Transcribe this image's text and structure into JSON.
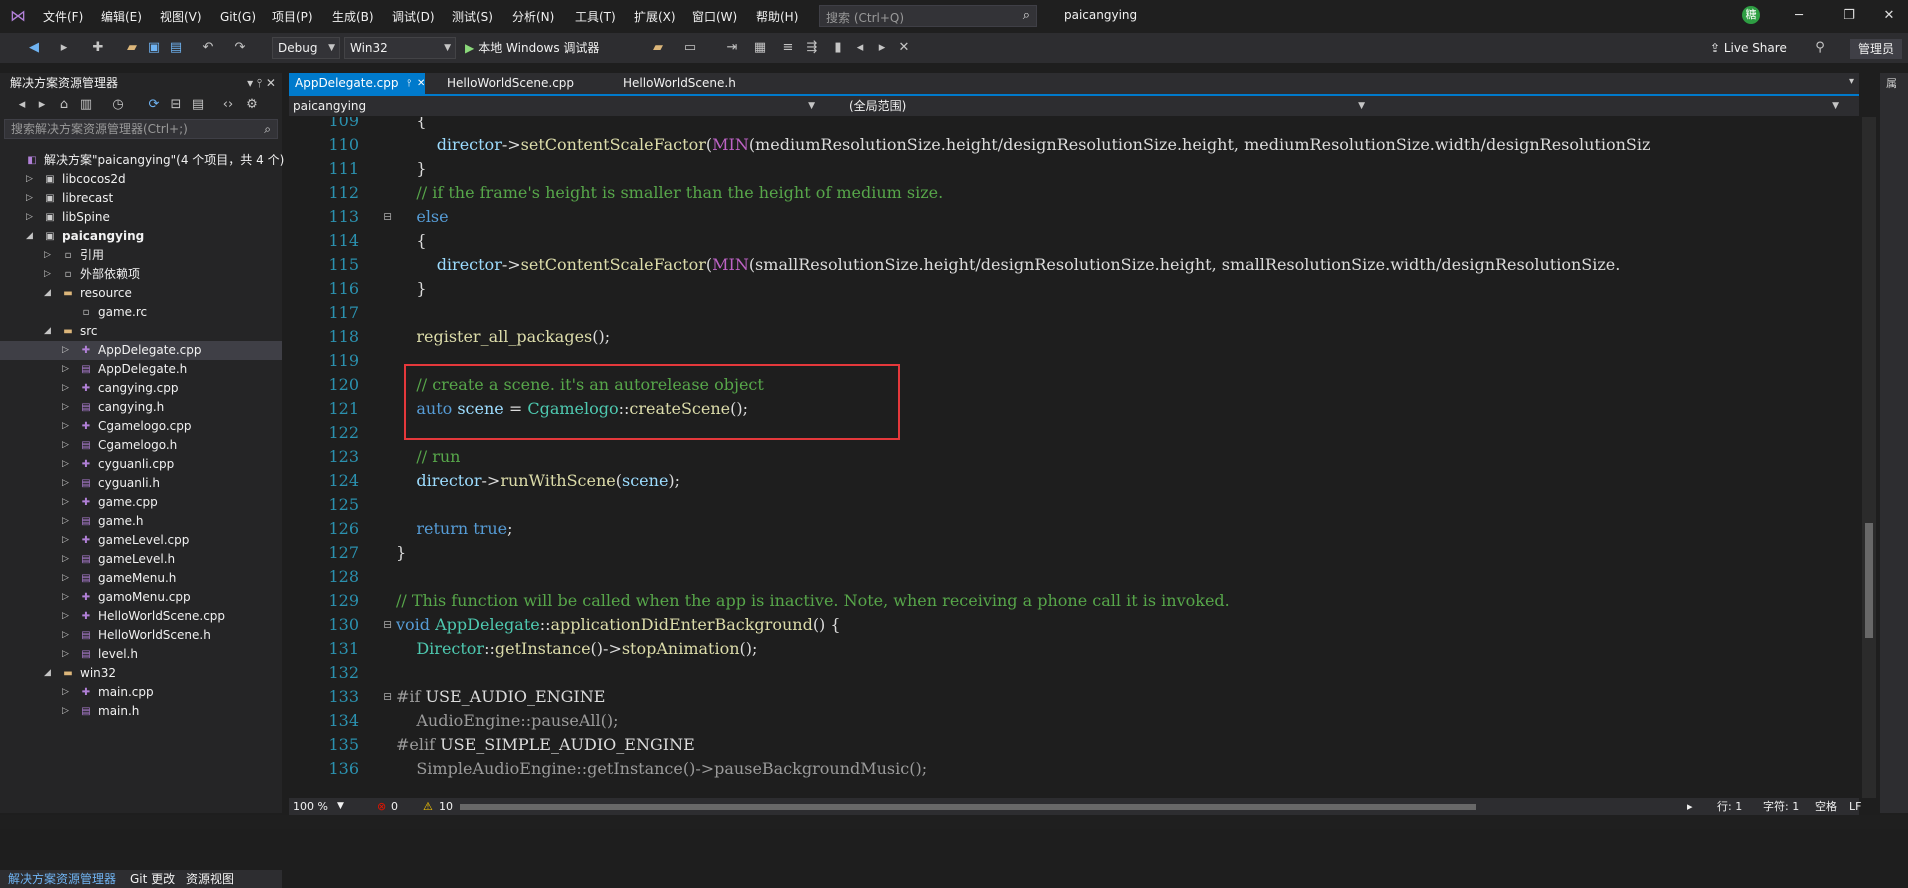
{
  "menubar": {
    "items": [
      "文件(F)",
      "编辑(E)",
      "视图(V)",
      "Git(G)",
      "项目(P)",
      "生成(B)",
      "调试(D)",
      "测试(S)",
      "分析(N)",
      "工具(T)",
      "扩展(X)",
      "窗口(W)",
      "帮助(H)"
    ],
    "search_placeholder": "搜索 (Ctrl+Q)",
    "solution_name": "paicangying",
    "avatar_letter": "糖"
  },
  "toolbar": {
    "config": "Debug",
    "platform": "Win32",
    "run_label": "本地 Windows 调试器",
    "liveshare": "Live Share",
    "admin": "管理员"
  },
  "solution_explorer": {
    "title": "解决方案资源管理器",
    "search_placeholder": "搜索解决方案资源管理器(Ctrl+;)",
    "tree": [
      {
        "label": "解决方案\"paicangying\"(4 个项目，共 4 个)",
        "indent": 0,
        "arrow": "",
        "icon": "sln"
      },
      {
        "label": "libcocos2d",
        "indent": 1,
        "arrow": "▷",
        "icon": "proj"
      },
      {
        "label": "librecast",
        "indent": 1,
        "arrow": "▷",
        "icon": "proj"
      },
      {
        "label": "libSpine",
        "indent": 1,
        "arrow": "▷",
        "icon": "proj"
      },
      {
        "label": "paicangying",
        "indent": 1,
        "arrow": "◢",
        "icon": "proj",
        "bold": true
      },
      {
        "label": "引用",
        "indent": 2,
        "arrow": "▷",
        "icon": "file"
      },
      {
        "label": "外部依赖项",
        "indent": 2,
        "arrow": "▷",
        "icon": "file"
      },
      {
        "label": "resource",
        "indent": 2,
        "arrow": "◢",
        "icon": "folder"
      },
      {
        "label": "game.rc",
        "indent": 3,
        "arrow": "",
        "icon": "file"
      },
      {
        "label": "src",
        "indent": 2,
        "arrow": "◢",
        "icon": "folder"
      },
      {
        "label": "AppDelegate.cpp",
        "indent": 3,
        "arrow": "▷",
        "icon": "cpp",
        "selected": true
      },
      {
        "label": "AppDelegate.h",
        "indent": 3,
        "arrow": "▷",
        "icon": "h"
      },
      {
        "label": "cangying.cpp",
        "indent": 3,
        "arrow": "▷",
        "icon": "cpp"
      },
      {
        "label": "cangying.h",
        "indent": 3,
        "arrow": "▷",
        "icon": "h"
      },
      {
        "label": "Cgamelogo.cpp",
        "indent": 3,
        "arrow": "▷",
        "icon": "cpp"
      },
      {
        "label": "Cgamelogo.h",
        "indent": 3,
        "arrow": "▷",
        "icon": "h"
      },
      {
        "label": "cyguanli.cpp",
        "indent": 3,
        "arrow": "▷",
        "icon": "cpp"
      },
      {
        "label": "cyguanli.h",
        "indent": 3,
        "arrow": "▷",
        "icon": "h"
      },
      {
        "label": "game.cpp",
        "indent": 3,
        "arrow": "▷",
        "icon": "cpp"
      },
      {
        "label": "game.h",
        "indent": 3,
        "arrow": "▷",
        "icon": "h"
      },
      {
        "label": "gameLevel.cpp",
        "indent": 3,
        "arrow": "▷",
        "icon": "cpp"
      },
      {
        "label": "gameLevel.h",
        "indent": 3,
        "arrow": "▷",
        "icon": "h"
      },
      {
        "label": "gameMenu.h",
        "indent": 3,
        "arrow": "▷",
        "icon": "h"
      },
      {
        "label": "gamoMenu.cpp",
        "indent": 3,
        "arrow": "▷",
        "icon": "cpp"
      },
      {
        "label": "HelloWorldScene.cpp",
        "indent": 3,
        "arrow": "▷",
        "icon": "cpp"
      },
      {
        "label": "HelloWorldScene.h",
        "indent": 3,
        "arrow": "▷",
        "icon": "h"
      },
      {
        "label": "level.h",
        "indent": 3,
        "arrow": "▷",
        "icon": "h"
      },
      {
        "label": "win32",
        "indent": 2,
        "arrow": "◢",
        "icon": "folder"
      },
      {
        "label": "main.cpp",
        "indent": 3,
        "arrow": "▷",
        "icon": "cpp"
      },
      {
        "label": "main.h",
        "indent": 3,
        "arrow": "▷",
        "icon": "h"
      }
    ],
    "bottom_tabs": [
      "解决方案资源管理器",
      "Git 更改",
      "资源视图"
    ]
  },
  "editor": {
    "tabs": [
      "AppDelegate.cpp",
      "HelloWorldScene.cpp",
      "HelloWorldScene.h"
    ],
    "nav_project": "paicangying",
    "nav_scope": "(全局范围)",
    "zoom": "100 %",
    "errors": "0",
    "warnings": "10",
    "status_line": "行: 1",
    "status_col": "字符: 1",
    "status_ws": "空格",
    "status_eol": "LF",
    "lines": [
      {
        "n": "109",
        "fold": "",
        "tokens": [
          [
            "    {",
            ""
          ]
        ]
      },
      {
        "n": "110",
        "fold": "",
        "tokens": [
          [
            "        ",
            ""
          ],
          [
            "director",
            "var"
          ],
          [
            "->",
            ""
          ],
          [
            "setContentScaleFactor",
            "fn"
          ],
          [
            "(",
            ""
          ],
          [
            "MIN",
            "mc"
          ],
          [
            "(mediumResolutionSize.height/designResolutionSize.height, mediumResolutionSize.width/designResolutionSiz",
            ""
          ]
        ]
      },
      {
        "n": "111",
        "fold": "",
        "tokens": [
          [
            "    }",
            ""
          ]
        ]
      },
      {
        "n": "112",
        "fold": "",
        "tokens": [
          [
            "    // if the frame's height is smaller than the height of medium size.",
            "cm"
          ]
        ]
      },
      {
        "n": "113",
        "fold": "⊟",
        "tokens": [
          [
            "    ",
            ""
          ],
          [
            "else",
            "kw"
          ]
        ]
      },
      {
        "n": "114",
        "fold": "",
        "tokens": [
          [
            "    {",
            ""
          ]
        ]
      },
      {
        "n": "115",
        "fold": "",
        "tokens": [
          [
            "        ",
            ""
          ],
          [
            "director",
            "var"
          ],
          [
            "->",
            ""
          ],
          [
            "setContentScaleFactor",
            "fn"
          ],
          [
            "(",
            ""
          ],
          [
            "MIN",
            "mc"
          ],
          [
            "(smallResolutionSize.height/designResolutionSize.height, smallResolutionSize.width/designResolutionSize.",
            ""
          ]
        ]
      },
      {
        "n": "116",
        "fold": "",
        "tokens": [
          [
            "    }",
            ""
          ]
        ]
      },
      {
        "n": "117",
        "fold": "",
        "tokens": [
          [
            "",
            ""
          ]
        ]
      },
      {
        "n": "118",
        "fold": "",
        "tokens": [
          [
            "    ",
            ""
          ],
          [
            "register_all_packages",
            "fn"
          ],
          [
            "();",
            ""
          ]
        ]
      },
      {
        "n": "119",
        "fold": "",
        "tokens": [
          [
            "",
            ""
          ]
        ]
      },
      {
        "n": "120",
        "fold": "",
        "tokens": [
          [
            "    // create a scene. it's an autorelease object",
            "cm"
          ]
        ]
      },
      {
        "n": "121",
        "fold": "",
        "tokens": [
          [
            "    ",
            ""
          ],
          [
            "auto",
            "kw"
          ],
          [
            " ",
            ""
          ],
          [
            "scene",
            "var"
          ],
          [
            " = ",
            ""
          ],
          [
            "Cgamelogo",
            "ty"
          ],
          [
            "::",
            ""
          ],
          [
            "createScene",
            "fn"
          ],
          [
            "();",
            ""
          ]
        ]
      },
      {
        "n": "122",
        "fold": "",
        "tokens": [
          [
            "",
            ""
          ]
        ]
      },
      {
        "n": "123",
        "fold": "",
        "tokens": [
          [
            "    // run",
            "cm"
          ]
        ]
      },
      {
        "n": "124",
        "fold": "",
        "tokens": [
          [
            "    ",
            ""
          ],
          [
            "director",
            "var"
          ],
          [
            "->",
            ""
          ],
          [
            "runWithScene",
            "fn"
          ],
          [
            "(",
            ""
          ],
          [
            "scene",
            "var"
          ],
          [
            ");",
            ""
          ]
        ]
      },
      {
        "n": "125",
        "fold": "",
        "tokens": [
          [
            "",
            ""
          ]
        ]
      },
      {
        "n": "126",
        "fold": "",
        "tokens": [
          [
            "    ",
            ""
          ],
          [
            "return",
            "kw"
          ],
          [
            " ",
            ""
          ],
          [
            "true",
            "kw"
          ],
          [
            ";",
            ""
          ]
        ]
      },
      {
        "n": "127",
        "fold": "",
        "tokens": [
          [
            "}",
            ""
          ]
        ]
      },
      {
        "n": "128",
        "fold": "",
        "tokens": [
          [
            "",
            ""
          ]
        ]
      },
      {
        "n": "129",
        "fold": "",
        "tokens": [
          [
            "// This function will be called when the app is inactive. Note, when receiving a phone call it is invoked.",
            "cm"
          ]
        ]
      },
      {
        "n": "130",
        "fold": "⊟",
        "tokens": [
          [
            "void",
            "kw"
          ],
          [
            " ",
            ""
          ],
          [
            "AppDelegate",
            "ty"
          ],
          [
            "::",
            ""
          ],
          [
            "applicationDidEnterBackground",
            "fn"
          ],
          [
            "() {",
            ""
          ]
        ]
      },
      {
        "n": "131",
        "fold": "",
        "tokens": [
          [
            "    ",
            ""
          ],
          [
            "Director",
            "ty"
          ],
          [
            "::",
            ""
          ],
          [
            "getInstance",
            "fn"
          ],
          [
            "()->",
            ""
          ],
          [
            "stopAnimation",
            "fn"
          ],
          [
            "();",
            ""
          ]
        ]
      },
      {
        "n": "132",
        "fold": "",
        "tokens": [
          [
            "",
            ""
          ]
        ]
      },
      {
        "n": "133",
        "fold": "⊟",
        "tokens": [
          [
            "#if",
            "pp"
          ],
          [
            " USE_AUDIO_ENGINE",
            ""
          ]
        ]
      },
      {
        "n": "134",
        "fold": "",
        "tokens": [
          [
            "    AudioEngine::pauseAll();",
            "pp"
          ]
        ]
      },
      {
        "n": "135",
        "fold": "",
        "tokens": [
          [
            "#elif",
            "pp"
          ],
          [
            " USE_SIMPLE_AUDIO_ENGINE",
            ""
          ]
        ]
      },
      {
        "n": "136",
        "fold": "",
        "tokens": [
          [
            "    SimpleAudioEngine::getInstance()->pauseBackgroundMusic();",
            "pp"
          ]
        ]
      }
    ]
  }
}
